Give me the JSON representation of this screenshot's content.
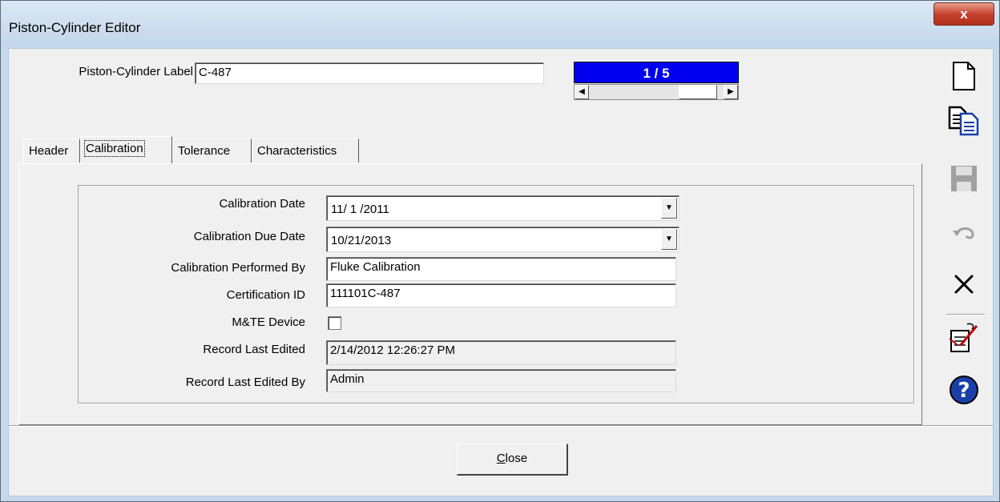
{
  "window": {
    "title": "Piston-Cylinder Editor",
    "close_glyph": "x"
  },
  "record": {
    "label_caption": "Piston-Cylinder Label",
    "label_value": "C-487",
    "position_text": "1 / 5"
  },
  "tabs": [
    {
      "label": "Header",
      "active": false
    },
    {
      "label": "Calibration",
      "active": true
    },
    {
      "label": "Tolerance",
      "active": false
    },
    {
      "label": "Characteristics",
      "active": false
    }
  ],
  "calibration": {
    "date_label": "Calibration Date",
    "date_value": "11/ 1 /2011",
    "due_label": "Calibration Due Date",
    "due_value": "10/21/2013",
    "performed_label": "Calibration Performed By",
    "performed_value": "Fluke Calibration",
    "cert_label": "Certification ID",
    "cert_value": "111101C-487",
    "mte_label": "M&TE Device",
    "mte_checked": false,
    "edited_label": "Record Last Edited",
    "edited_value": "2/14/2012 12:26:27 PM",
    "edited_by_label": "Record Last Edited By",
    "edited_by_value": "Admin"
  },
  "footer": {
    "close_label": "Close",
    "close_mnemonic": "C",
    "close_rest": "lose"
  },
  "toolbar": {
    "icons": [
      "new-document-icon",
      "copy-icon",
      "save-icon",
      "undo-icon",
      "delete-icon",
      "edit-signature-icon",
      "help-icon"
    ],
    "accent": "#1a3fa8"
  },
  "colors": {
    "counter_bg": "#0000ee",
    "titlebar": "#c6d9ec",
    "close_button": "#c7432f"
  }
}
